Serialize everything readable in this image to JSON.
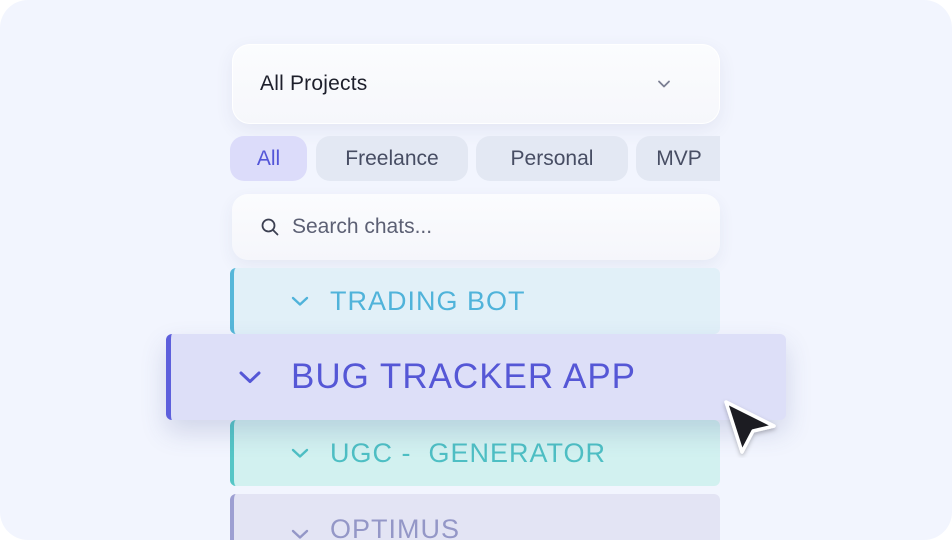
{
  "project_select": {
    "label": "All Projects",
    "icon": "chevron-down-icon"
  },
  "filters": [
    {
      "label": "All",
      "active": true
    },
    {
      "label": "Freelance",
      "active": false
    },
    {
      "label": "Personal",
      "active": false
    },
    {
      "label": "MVP",
      "active": false
    }
  ],
  "search": {
    "placeholder": "Search chats...",
    "value": "",
    "icon": "search-icon"
  },
  "groups": [
    {
      "label": "TRADING BOT",
      "color": "#56b7d9"
    },
    {
      "label": "BUG TRACKER APP",
      "color": "#5d5fdc",
      "dragging": true
    },
    {
      "label": "UGC -  GENERATOR",
      "color": "#56c6c6"
    },
    {
      "label": "OPTIMUS",
      "color": "#9d9fd2"
    }
  ],
  "colors": {
    "background": "#f2f5fe",
    "accent": "#5355d8"
  },
  "cursor_icon": "pointer-arrow-icon"
}
